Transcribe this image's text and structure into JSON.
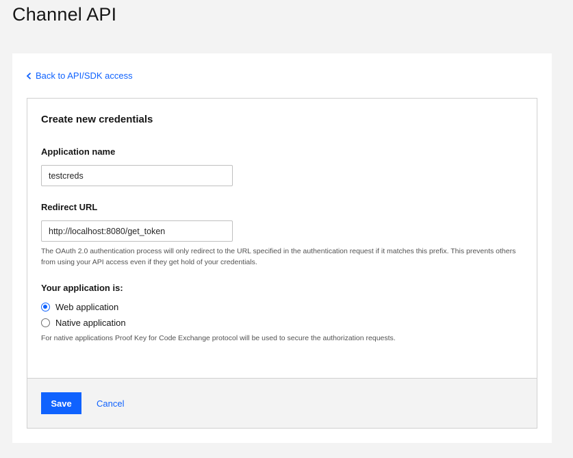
{
  "page": {
    "title": "Channel API"
  },
  "nav": {
    "back_label": "Back to API/SDK access",
    "back_icon": "chevron-left-icon"
  },
  "form": {
    "title": "Create new credentials",
    "app_name": {
      "label": "Application name",
      "value": "testcreds"
    },
    "redirect_url": {
      "label": "Redirect URL",
      "value": "http://localhost:8080/get_token",
      "helper": "The OAuth 2.0 authentication process will only redirect to the URL specified in the authentication request if it matches this prefix. This prevents others from using your API access even if they get hold of your credentials."
    },
    "app_type": {
      "label": "Your application is:",
      "options": [
        {
          "label": "Web application",
          "selected": true
        },
        {
          "label": "Native application",
          "selected": false
        }
      ],
      "helper": "For native applications Proof Key for Code Exchange protocol will be used to secure the authorization requests."
    }
  },
  "footer": {
    "save_label": "Save",
    "cancel_label": "Cancel"
  },
  "colors": {
    "accent": "#0f62fe",
    "page_bg": "#f3f3f3",
    "text": "#161616"
  }
}
